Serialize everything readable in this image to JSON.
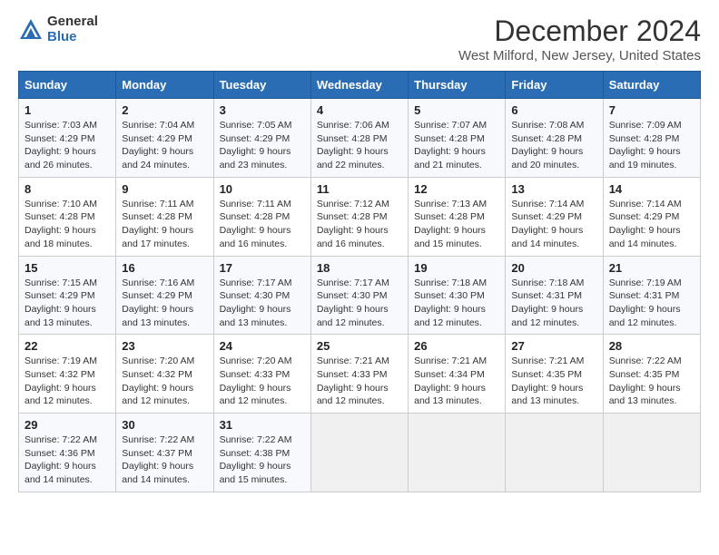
{
  "logo": {
    "general": "General",
    "blue": "Blue"
  },
  "title": "December 2024",
  "subtitle": "West Milford, New Jersey, United States",
  "weekdays": [
    "Sunday",
    "Monday",
    "Tuesday",
    "Wednesday",
    "Thursday",
    "Friday",
    "Saturday"
  ],
  "weeks": [
    [
      {
        "day": "1",
        "sunrise": "Sunrise: 7:03 AM",
        "sunset": "Sunset: 4:29 PM",
        "daylight": "Daylight: 9 hours and 26 minutes."
      },
      {
        "day": "2",
        "sunrise": "Sunrise: 7:04 AM",
        "sunset": "Sunset: 4:29 PM",
        "daylight": "Daylight: 9 hours and 24 minutes."
      },
      {
        "day": "3",
        "sunrise": "Sunrise: 7:05 AM",
        "sunset": "Sunset: 4:29 PM",
        "daylight": "Daylight: 9 hours and 23 minutes."
      },
      {
        "day": "4",
        "sunrise": "Sunrise: 7:06 AM",
        "sunset": "Sunset: 4:28 PM",
        "daylight": "Daylight: 9 hours and 22 minutes."
      },
      {
        "day": "5",
        "sunrise": "Sunrise: 7:07 AM",
        "sunset": "Sunset: 4:28 PM",
        "daylight": "Daylight: 9 hours and 21 minutes."
      },
      {
        "day": "6",
        "sunrise": "Sunrise: 7:08 AM",
        "sunset": "Sunset: 4:28 PM",
        "daylight": "Daylight: 9 hours and 20 minutes."
      },
      {
        "day": "7",
        "sunrise": "Sunrise: 7:09 AM",
        "sunset": "Sunset: 4:28 PM",
        "daylight": "Daylight: 9 hours and 19 minutes."
      }
    ],
    [
      {
        "day": "8",
        "sunrise": "Sunrise: 7:10 AM",
        "sunset": "Sunset: 4:28 PM",
        "daylight": "Daylight: 9 hours and 18 minutes."
      },
      {
        "day": "9",
        "sunrise": "Sunrise: 7:11 AM",
        "sunset": "Sunset: 4:28 PM",
        "daylight": "Daylight: 9 hours and 17 minutes."
      },
      {
        "day": "10",
        "sunrise": "Sunrise: 7:11 AM",
        "sunset": "Sunset: 4:28 PM",
        "daylight": "Daylight: 9 hours and 16 minutes."
      },
      {
        "day": "11",
        "sunrise": "Sunrise: 7:12 AM",
        "sunset": "Sunset: 4:28 PM",
        "daylight": "Daylight: 9 hours and 16 minutes."
      },
      {
        "day": "12",
        "sunrise": "Sunrise: 7:13 AM",
        "sunset": "Sunset: 4:28 PM",
        "daylight": "Daylight: 9 hours and 15 minutes."
      },
      {
        "day": "13",
        "sunrise": "Sunrise: 7:14 AM",
        "sunset": "Sunset: 4:29 PM",
        "daylight": "Daylight: 9 hours and 14 minutes."
      },
      {
        "day": "14",
        "sunrise": "Sunrise: 7:14 AM",
        "sunset": "Sunset: 4:29 PM",
        "daylight": "Daylight: 9 hours and 14 minutes."
      }
    ],
    [
      {
        "day": "15",
        "sunrise": "Sunrise: 7:15 AM",
        "sunset": "Sunset: 4:29 PM",
        "daylight": "Daylight: 9 hours and 13 minutes."
      },
      {
        "day": "16",
        "sunrise": "Sunrise: 7:16 AM",
        "sunset": "Sunset: 4:29 PM",
        "daylight": "Daylight: 9 hours and 13 minutes."
      },
      {
        "day": "17",
        "sunrise": "Sunrise: 7:17 AM",
        "sunset": "Sunset: 4:30 PM",
        "daylight": "Daylight: 9 hours and 13 minutes."
      },
      {
        "day": "18",
        "sunrise": "Sunrise: 7:17 AM",
        "sunset": "Sunset: 4:30 PM",
        "daylight": "Daylight: 9 hours and 12 minutes."
      },
      {
        "day": "19",
        "sunrise": "Sunrise: 7:18 AM",
        "sunset": "Sunset: 4:30 PM",
        "daylight": "Daylight: 9 hours and 12 minutes."
      },
      {
        "day": "20",
        "sunrise": "Sunrise: 7:18 AM",
        "sunset": "Sunset: 4:31 PM",
        "daylight": "Daylight: 9 hours and 12 minutes."
      },
      {
        "day": "21",
        "sunrise": "Sunrise: 7:19 AM",
        "sunset": "Sunset: 4:31 PM",
        "daylight": "Daylight: 9 hours and 12 minutes."
      }
    ],
    [
      {
        "day": "22",
        "sunrise": "Sunrise: 7:19 AM",
        "sunset": "Sunset: 4:32 PM",
        "daylight": "Daylight: 9 hours and 12 minutes."
      },
      {
        "day": "23",
        "sunrise": "Sunrise: 7:20 AM",
        "sunset": "Sunset: 4:32 PM",
        "daylight": "Daylight: 9 hours and 12 minutes."
      },
      {
        "day": "24",
        "sunrise": "Sunrise: 7:20 AM",
        "sunset": "Sunset: 4:33 PM",
        "daylight": "Daylight: 9 hours and 12 minutes."
      },
      {
        "day": "25",
        "sunrise": "Sunrise: 7:21 AM",
        "sunset": "Sunset: 4:33 PM",
        "daylight": "Daylight: 9 hours and 12 minutes."
      },
      {
        "day": "26",
        "sunrise": "Sunrise: 7:21 AM",
        "sunset": "Sunset: 4:34 PM",
        "daylight": "Daylight: 9 hours and 13 minutes."
      },
      {
        "day": "27",
        "sunrise": "Sunrise: 7:21 AM",
        "sunset": "Sunset: 4:35 PM",
        "daylight": "Daylight: 9 hours and 13 minutes."
      },
      {
        "day": "28",
        "sunrise": "Sunrise: 7:22 AM",
        "sunset": "Sunset: 4:35 PM",
        "daylight": "Daylight: 9 hours and 13 minutes."
      }
    ],
    [
      {
        "day": "29",
        "sunrise": "Sunrise: 7:22 AM",
        "sunset": "Sunset: 4:36 PM",
        "daylight": "Daylight: 9 hours and 14 minutes."
      },
      {
        "day": "30",
        "sunrise": "Sunrise: 7:22 AM",
        "sunset": "Sunset: 4:37 PM",
        "daylight": "Daylight: 9 hours and 14 minutes."
      },
      {
        "day": "31",
        "sunrise": "Sunrise: 7:22 AM",
        "sunset": "Sunset: 4:38 PM",
        "daylight": "Daylight: 9 hours and 15 minutes."
      },
      null,
      null,
      null,
      null
    ]
  ]
}
